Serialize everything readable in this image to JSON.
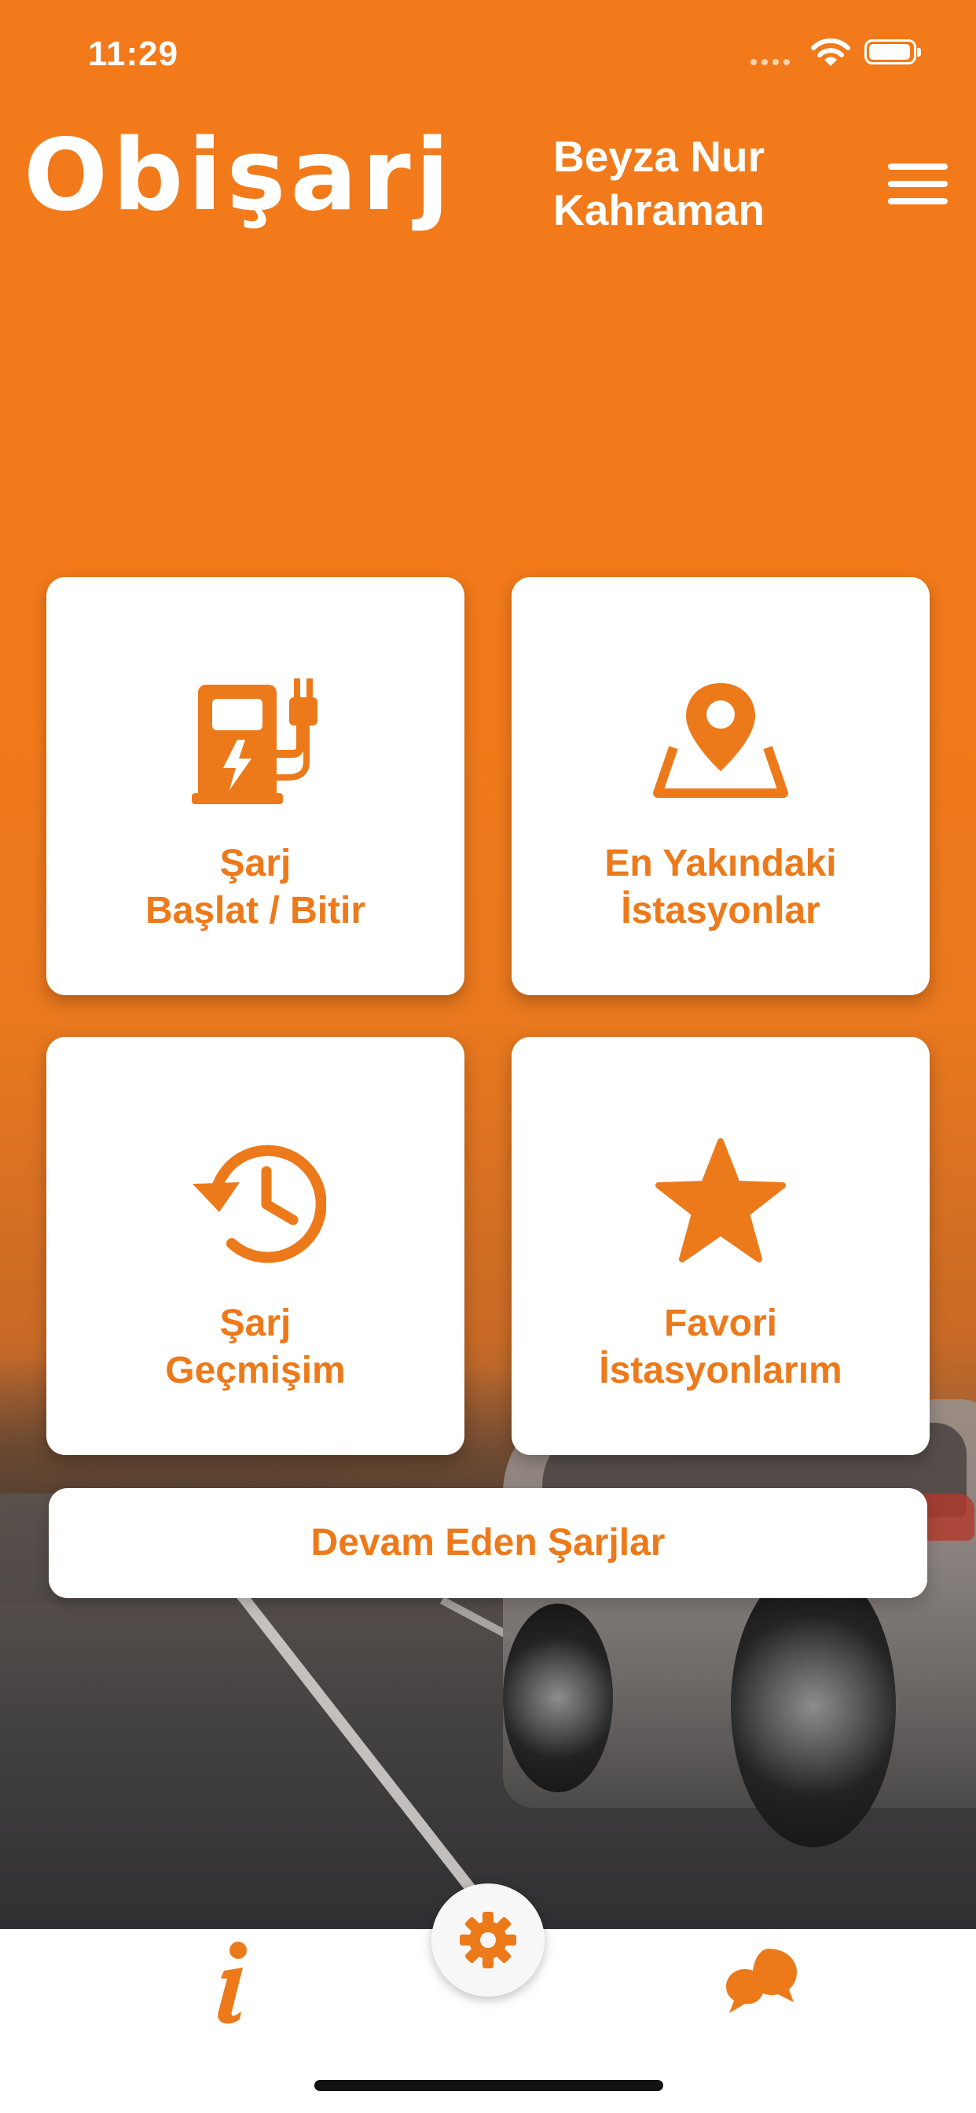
{
  "status_bar": {
    "time": "11:29"
  },
  "header": {
    "logo_text": "Obişarj",
    "user_name_line1": "Beyza Nur",
    "user_name_line2": "Kahraman",
    "menu_icon": "hamburger-menu-icon"
  },
  "cards": [
    {
      "icon": "charging-station-icon",
      "line1": "Şarj",
      "line2": "Başlat / Bitir"
    },
    {
      "icon": "map-pin-icon",
      "line1": "En Yakındaki",
      "line2": "İstasyonlar"
    },
    {
      "icon": "history-clock-icon",
      "line1": "Şarj",
      "line2": "Geçmişim"
    },
    {
      "icon": "star-icon",
      "line1": "Favori",
      "line2": "İstasyonlarım"
    }
  ],
  "ongoing_button": {
    "label": "Devam Eden Şarjlar"
  },
  "bottom_nav": {
    "left_icon": "info-icon",
    "center_icon": "gear-icon",
    "right_icon": "chat-bubbles-icon"
  },
  "colors": {
    "accent": "#F27A1A",
    "card_text": "#EC7A1B",
    "card_bg": "#FFFFFF"
  }
}
